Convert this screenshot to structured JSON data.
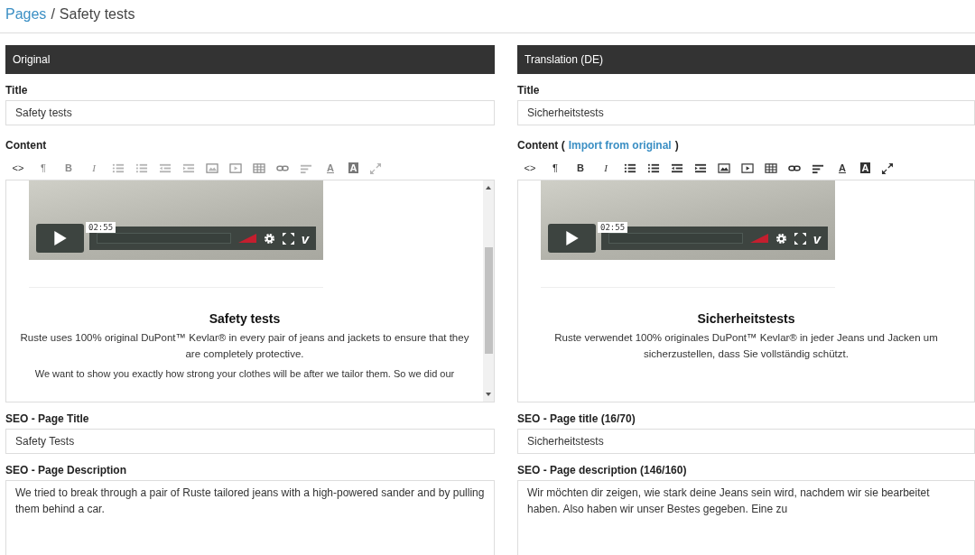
{
  "breadcrumb": {
    "link": "Pages",
    "separator": "/",
    "current": "Safety tests"
  },
  "panels": [
    {
      "header": "Original",
      "title_label": "Title",
      "title_value": "Safety tests",
      "content_label": "Content",
      "toolbar_disabled": true,
      "toolbar": [
        {
          "kind": "code",
          "text": "<>"
        },
        {
          "kind": "char",
          "text": "¶"
        },
        {
          "kind": "bold",
          "text": "B"
        },
        {
          "kind": "italic",
          "text": "I"
        },
        {
          "kind": "ul"
        },
        {
          "kind": "ol"
        },
        {
          "kind": "outdent"
        },
        {
          "kind": "indent"
        },
        {
          "kind": "image"
        },
        {
          "kind": "video"
        },
        {
          "kind": "table"
        },
        {
          "kind": "link"
        },
        {
          "kind": "align"
        },
        {
          "kind": "fontcolor",
          "text": "A"
        },
        {
          "kind": "bgcolor",
          "text": "A"
        },
        {
          "kind": "fullscreen"
        }
      ],
      "editor": {
        "scrollbar": true,
        "video": {
          "time": "02:55",
          "logo": "v"
        },
        "heading": "Safety tests",
        "paragraphs": [
          "Ruste uses 100% original DuPont™ Kevlar® in every pair of jeans and jackets to ensure that they are completely protective.",
          "We want to show you exactly how strong your clothes will be after we tailor them. So we did our"
        ]
      },
      "seo_title_label": "SEO - Page Title",
      "seo_title_value": "Safety Tests",
      "seo_desc_label": "SEO - Page Description",
      "seo_desc_value": "We tried to break through a pair of Ruste tailored jeans with a high-powered sander and by pulling them behind a car."
    },
    {
      "header": "Translation (DE)",
      "title_label": "Title",
      "title_value": "Sicherheitstests",
      "content_label": "Content (",
      "content_link": "Import from original",
      "content_suffix": ")",
      "toolbar_disabled": false,
      "toolbar": [
        {
          "kind": "code",
          "text": "<>"
        },
        {
          "kind": "char",
          "text": "¶"
        },
        {
          "kind": "bold",
          "text": "B"
        },
        {
          "kind": "italic",
          "text": "I"
        },
        {
          "kind": "ul"
        },
        {
          "kind": "ol"
        },
        {
          "kind": "outdent"
        },
        {
          "kind": "indent"
        },
        {
          "kind": "image"
        },
        {
          "kind": "video"
        },
        {
          "kind": "table"
        },
        {
          "kind": "link"
        },
        {
          "kind": "align"
        },
        {
          "kind": "fontcolor",
          "text": "A"
        },
        {
          "kind": "bgcolor",
          "text": "A"
        },
        {
          "kind": "fullscreen"
        }
      ],
      "editor": {
        "scrollbar": false,
        "video": {
          "time": "02:55",
          "logo": "v"
        },
        "heading": "Sicherheitstests",
        "paragraphs": [
          "Ruste verwendet 100% originales DuPont™ Kevlar® in jeder Jeans und Jacken um sicherzustellen, dass Sie vollständig schützt."
        ]
      },
      "seo_title_label": "SEO - Page title (16/70)",
      "seo_title_value": "Sicherheitstests",
      "seo_desc_label": "SEO - Page description (146/160)",
      "seo_desc_value": "Wir möchten dir zeigen, wie stark deine Jeans sein wird, nachdem wir sie bearbeitet haben. Also haben wir unser Bestes gegeben. Eine zu"
    }
  ]
}
